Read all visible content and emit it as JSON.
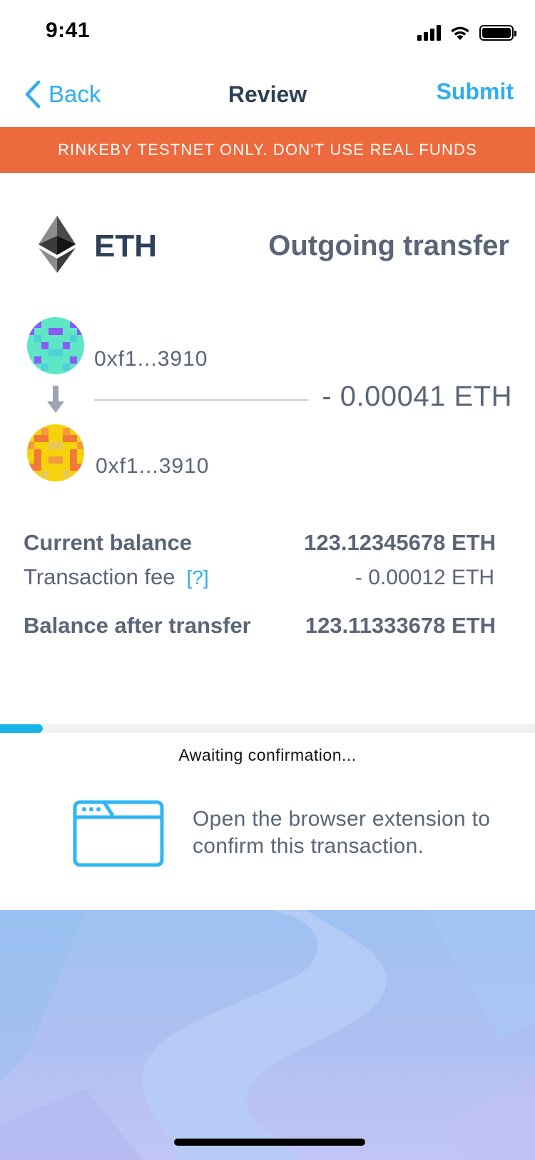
{
  "status_bar": {
    "time": "9:41"
  },
  "nav": {
    "back_label": "Back",
    "title": "Review",
    "submit_label": "Submit"
  },
  "banner": {
    "text": "RINKEBY TESTNET ONLY. DON'T USE REAL FUNDS"
  },
  "token": {
    "symbol": "ETH",
    "transfer_type": "Outgoing transfer",
    "icon": "ethereum-icon"
  },
  "transfer": {
    "from_address": "0xf1...3910",
    "to_address": "0xf1...3910",
    "amount": "- 0.00041 ETH"
  },
  "balances": {
    "current_label": "Current balance",
    "current_value": "123.12345678 ETH",
    "fee_label": "Transaction fee",
    "fee_help": "[?]",
    "fee_value": "- 0.00012 ETH",
    "after_label": "Balance after transfer",
    "after_value": "123.11333678 ETH"
  },
  "confirmation": {
    "progress_fraction": 0.08,
    "status": "Awaiting confirmation...",
    "instruction": "Open the browser extension to confirm this transaction.",
    "icon": "browser-window-icon"
  },
  "colors": {
    "accent": "#2eaef0",
    "banner": "#ec6a3d",
    "progress": "#18b4e6",
    "title": "#2e4057",
    "text": "#5a6577"
  }
}
